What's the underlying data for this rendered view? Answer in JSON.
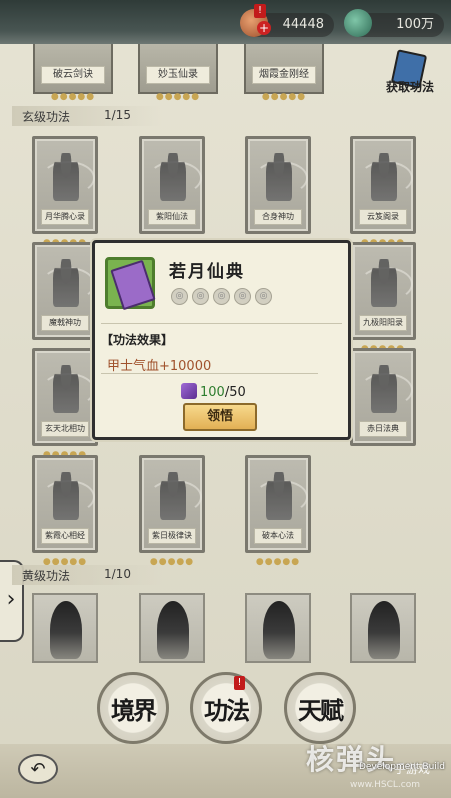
{
  "resources": {
    "gem_value": "44448",
    "jade_value": "100万",
    "gem_badge": "!"
  },
  "top_row_cards": [
    "破云剑诀",
    "妙玉仙录",
    "烟霞金刚经"
  ],
  "acquire": {
    "label": "获取功法"
  },
  "section_xuan": {
    "title": "玄级功法",
    "count": "1/15"
  },
  "xuan_cards": [
    "月华腾心录",
    "紫阳仙法",
    "合身神功",
    "云笈阁录",
    "魔戟神功",
    "",
    "",
    "九极阳阳录",
    "玄天北相功",
    "",
    "",
    "赤日法典",
    "紫霞心相经",
    "紫日极律诀",
    "破本心法"
  ],
  "section_huang": {
    "title": "黄级功法",
    "count": "1/10"
  },
  "modal": {
    "title": "若月仙典",
    "effect_heading": "【功法效果】",
    "effect_value": "甲士气血+10000",
    "cost_have": "100",
    "cost_need": "/50",
    "learn_label": "领悟",
    "star_glyph": "◎"
  },
  "nav": {
    "realm": "境界",
    "technique": "功法",
    "talent": "天赋",
    "technique_badge": "!"
  },
  "footer": {
    "back_glyph": "↶",
    "dev_build": "Development Build",
    "watermark": "核弹头",
    "watermark_sub": "手游戏",
    "watermark_url": "www.HSCL.com"
  },
  "colors": {
    "accent_gold": "#c8a653",
    "cost_have": "#2e7d2e",
    "effect_text": "#a0522d",
    "badge_red": "#c21b1b"
  },
  "icons": [
    "gem-icon",
    "jade-icon",
    "book-icon",
    "purple-gem-icon",
    "arrow-right-icon",
    "back-icon"
  ]
}
